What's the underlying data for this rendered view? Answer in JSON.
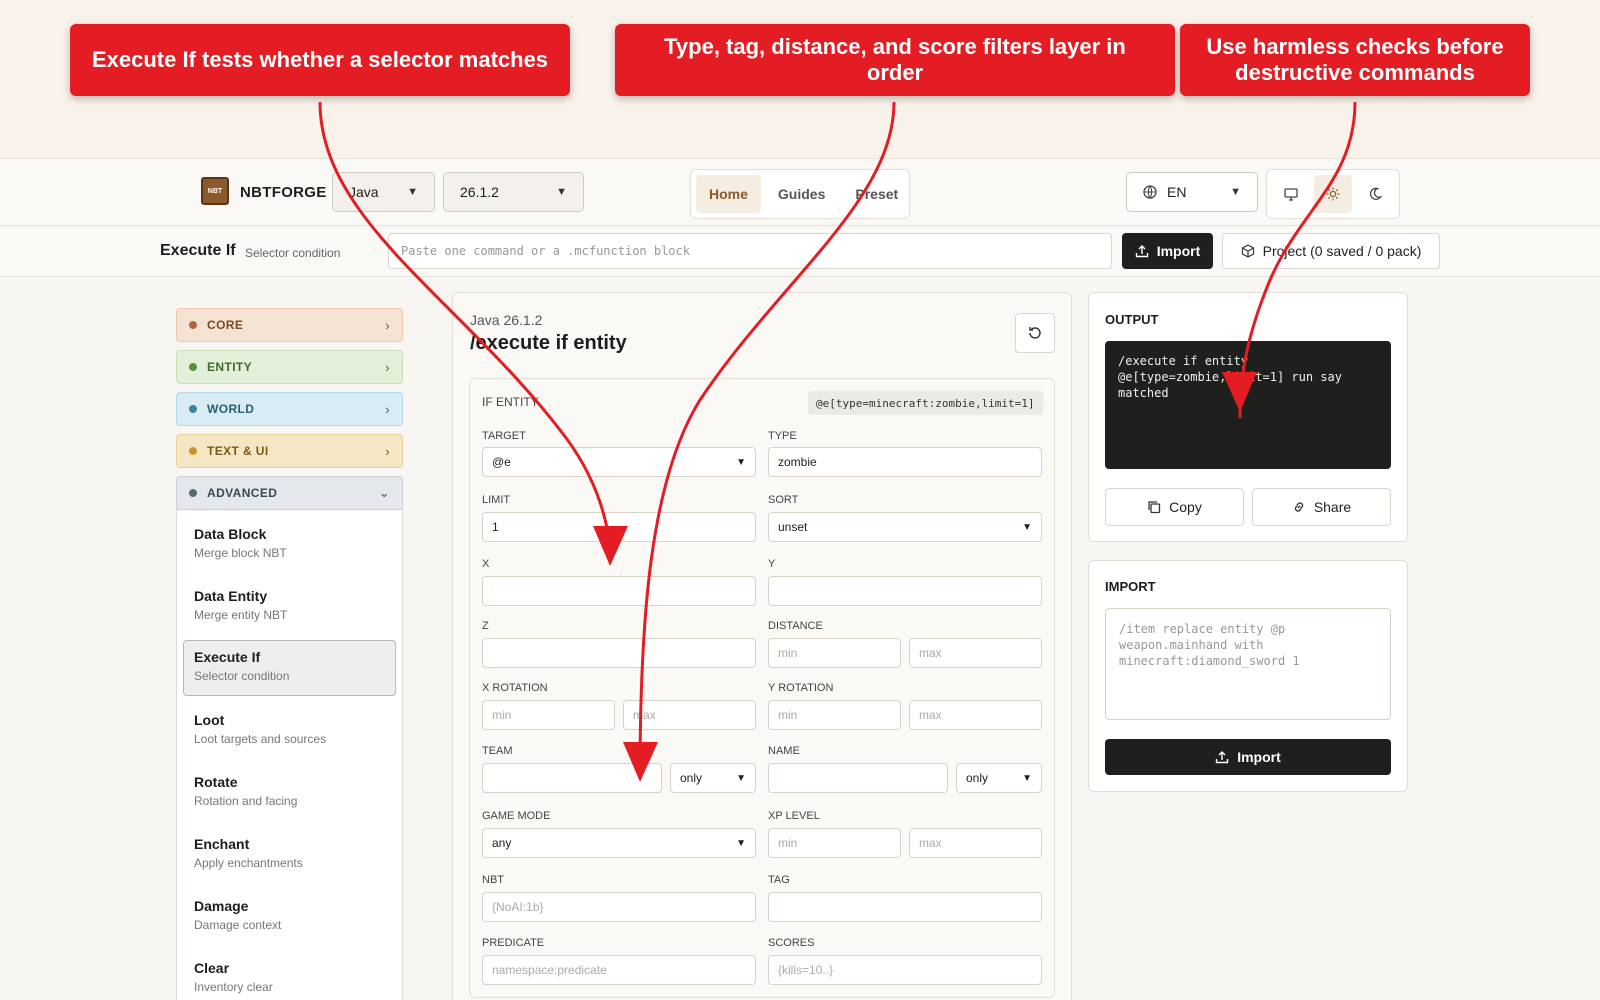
{
  "callouts": [
    "Execute If tests whether a selector matches",
    "Type, tag, distance, and score filters layer in order",
    "Use harmless checks before destructive commands"
  ],
  "nav": {
    "logo_text": "NBT",
    "brand": "NBTFORGE",
    "edition": "Java",
    "version": "26.1.2",
    "tabs": [
      "Home",
      "Guides",
      "Preset"
    ],
    "language": "EN"
  },
  "subbar": {
    "title": "Execute If",
    "desc": "Selector condition",
    "paste_placeholder": "Paste one command or a .mcfunction block",
    "import": "Import",
    "project": "Project (0 saved / 0 pack)"
  },
  "categories": [
    "CORE",
    "ENTITY",
    "WORLD",
    "TEXT & UI",
    "ADVANCED"
  ],
  "tools": [
    {
      "name": "Data Block",
      "desc": "Merge block NBT"
    },
    {
      "name": "Data Entity",
      "desc": "Merge entity NBT"
    },
    {
      "name": "Execute If",
      "desc": "Selector condition"
    },
    {
      "name": "Loot",
      "desc": "Loot targets and sources"
    },
    {
      "name": "Rotate",
      "desc": "Rotation and facing"
    },
    {
      "name": "Enchant",
      "desc": "Apply enchantments"
    },
    {
      "name": "Damage",
      "desc": "Damage context"
    },
    {
      "name": "Clear",
      "desc": "Inventory clear"
    }
  ],
  "editor": {
    "edition": "Java 26.1.2",
    "title": "/execute if entity",
    "section": "IF ENTITY",
    "selector": "@e[type=minecraft:zombie,limit=1]",
    "labels": {
      "target": "TARGET",
      "type": "TYPE",
      "limit": "LIMIT",
      "sort": "SORT",
      "x": "X",
      "y": "Y",
      "z": "Z",
      "distance": "DISTANCE",
      "xrot": "X ROTATION",
      "yrot": "Y ROTATION",
      "team": "TEAM",
      "name": "NAME",
      "gamemode": "GAME MODE",
      "xp": "XP LEVEL",
      "nbt": "NBT",
      "tag": "TAG",
      "predicate": "PREDICATE",
      "scores": "SCORES"
    },
    "values": {
      "target": "@e",
      "type": "zombie",
      "limit": "1",
      "sort": "unset",
      "team_mode": "only",
      "name_mode": "only",
      "gamemode": "any"
    },
    "placeholders": {
      "min": "min",
      "max": "max",
      "nbt": "{NoAI:1b}",
      "predicate": "namespace:predicate",
      "scores": "{kills=10..}"
    }
  },
  "output": {
    "title": "OUTPUT",
    "lines": [
      "/execute if entity",
      "@e[type=zombie,limit=1] run say",
      "matched"
    ],
    "copy": "Copy",
    "share": "Share"
  },
  "import_panel": {
    "title": "IMPORT",
    "placeholder_lines": [
      "/item replace entity @p",
      "weapon.mainhand with",
      "minecraft:diamond_sword 1"
    ],
    "button": "Import"
  },
  "colors": {
    "callout": "#e41c23",
    "core": "#f6e2d3",
    "entity": "#e2efd9",
    "world": "#d9ecf3",
    "text_ui": "#f5e7c4",
    "advanced": "#e4e8ec"
  }
}
